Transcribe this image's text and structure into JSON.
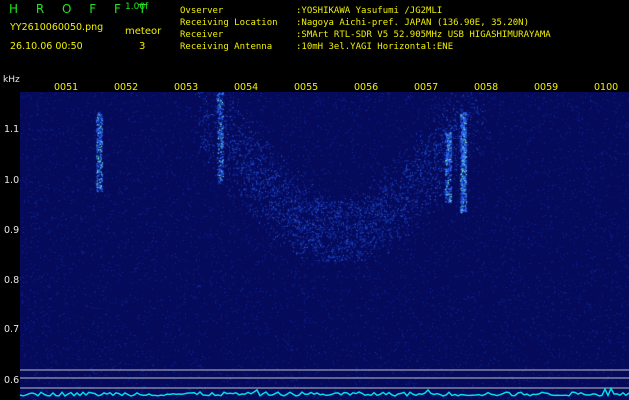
{
  "header": {
    "brand": "H R O F F T",
    "version": "1.00f",
    "filename": "YY2610060050.png",
    "meteor_label": "meteor",
    "datetime": "26.10.06 00:50",
    "meteor_count": "3"
  },
  "station": {
    "observer_label": "Ovserver",
    "observer_value": ":YOSHIKAWA Yasufumi /JG2MLI",
    "location_label": "Receiving Location",
    "location_value": ":Nagoya Aichi-pref. JAPAN (136.90E, 35.20N)",
    "receiver_label": "Receiver",
    "receiver_value": ":SMArt RTL-SDR V5 52.905MHz USB HIGASHIMURAYAMA",
    "antenna_label": "Receiving Antenna",
    "antenna_value": ":10mH 3el.YAGI Horizontal:ENE"
  },
  "spectrogram": {
    "unit_label": "kHz",
    "time_ticks": [
      "0051",
      "0052",
      "0053",
      "0054",
      "0055",
      "0056",
      "0057",
      "0058",
      "0059",
      "0100"
    ],
    "freq_ticks": [
      "1.1",
      "1.0",
      "0.9",
      "0.8",
      "0.7",
      "0.6"
    ],
    "background_color": "#050a5a",
    "signal_color": "#2b6bff",
    "hot_color": "#7fffd4"
  }
}
